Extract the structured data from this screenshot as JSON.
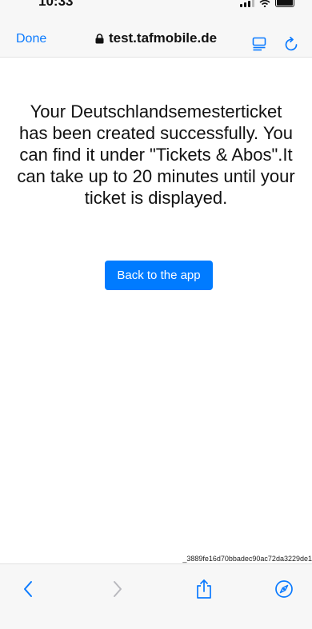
{
  "status_bar": {
    "time": "10:33"
  },
  "nav": {
    "done_label": "Done",
    "url": "test.tafmobile.de"
  },
  "main": {
    "message": "Your Deutschlandsemesterticket has been created successfully. You can find it under \"Tickets & Abos\".It can take up to 20 minutes until your ticket is displayed.",
    "button_label": "Back to the app"
  },
  "footer": {
    "trace_id": "_3889fe16d70bbadec90ac72da3229de1"
  },
  "colors": {
    "accent": "#0a7aff",
    "button": "#007bff",
    "bar_bg": "#f7f7f7"
  },
  "icons": [
    "lock-icon",
    "reader-icon",
    "reload-icon",
    "back-arrow-icon",
    "forward-arrow-icon",
    "share-icon",
    "safari-compass-icon"
  ]
}
